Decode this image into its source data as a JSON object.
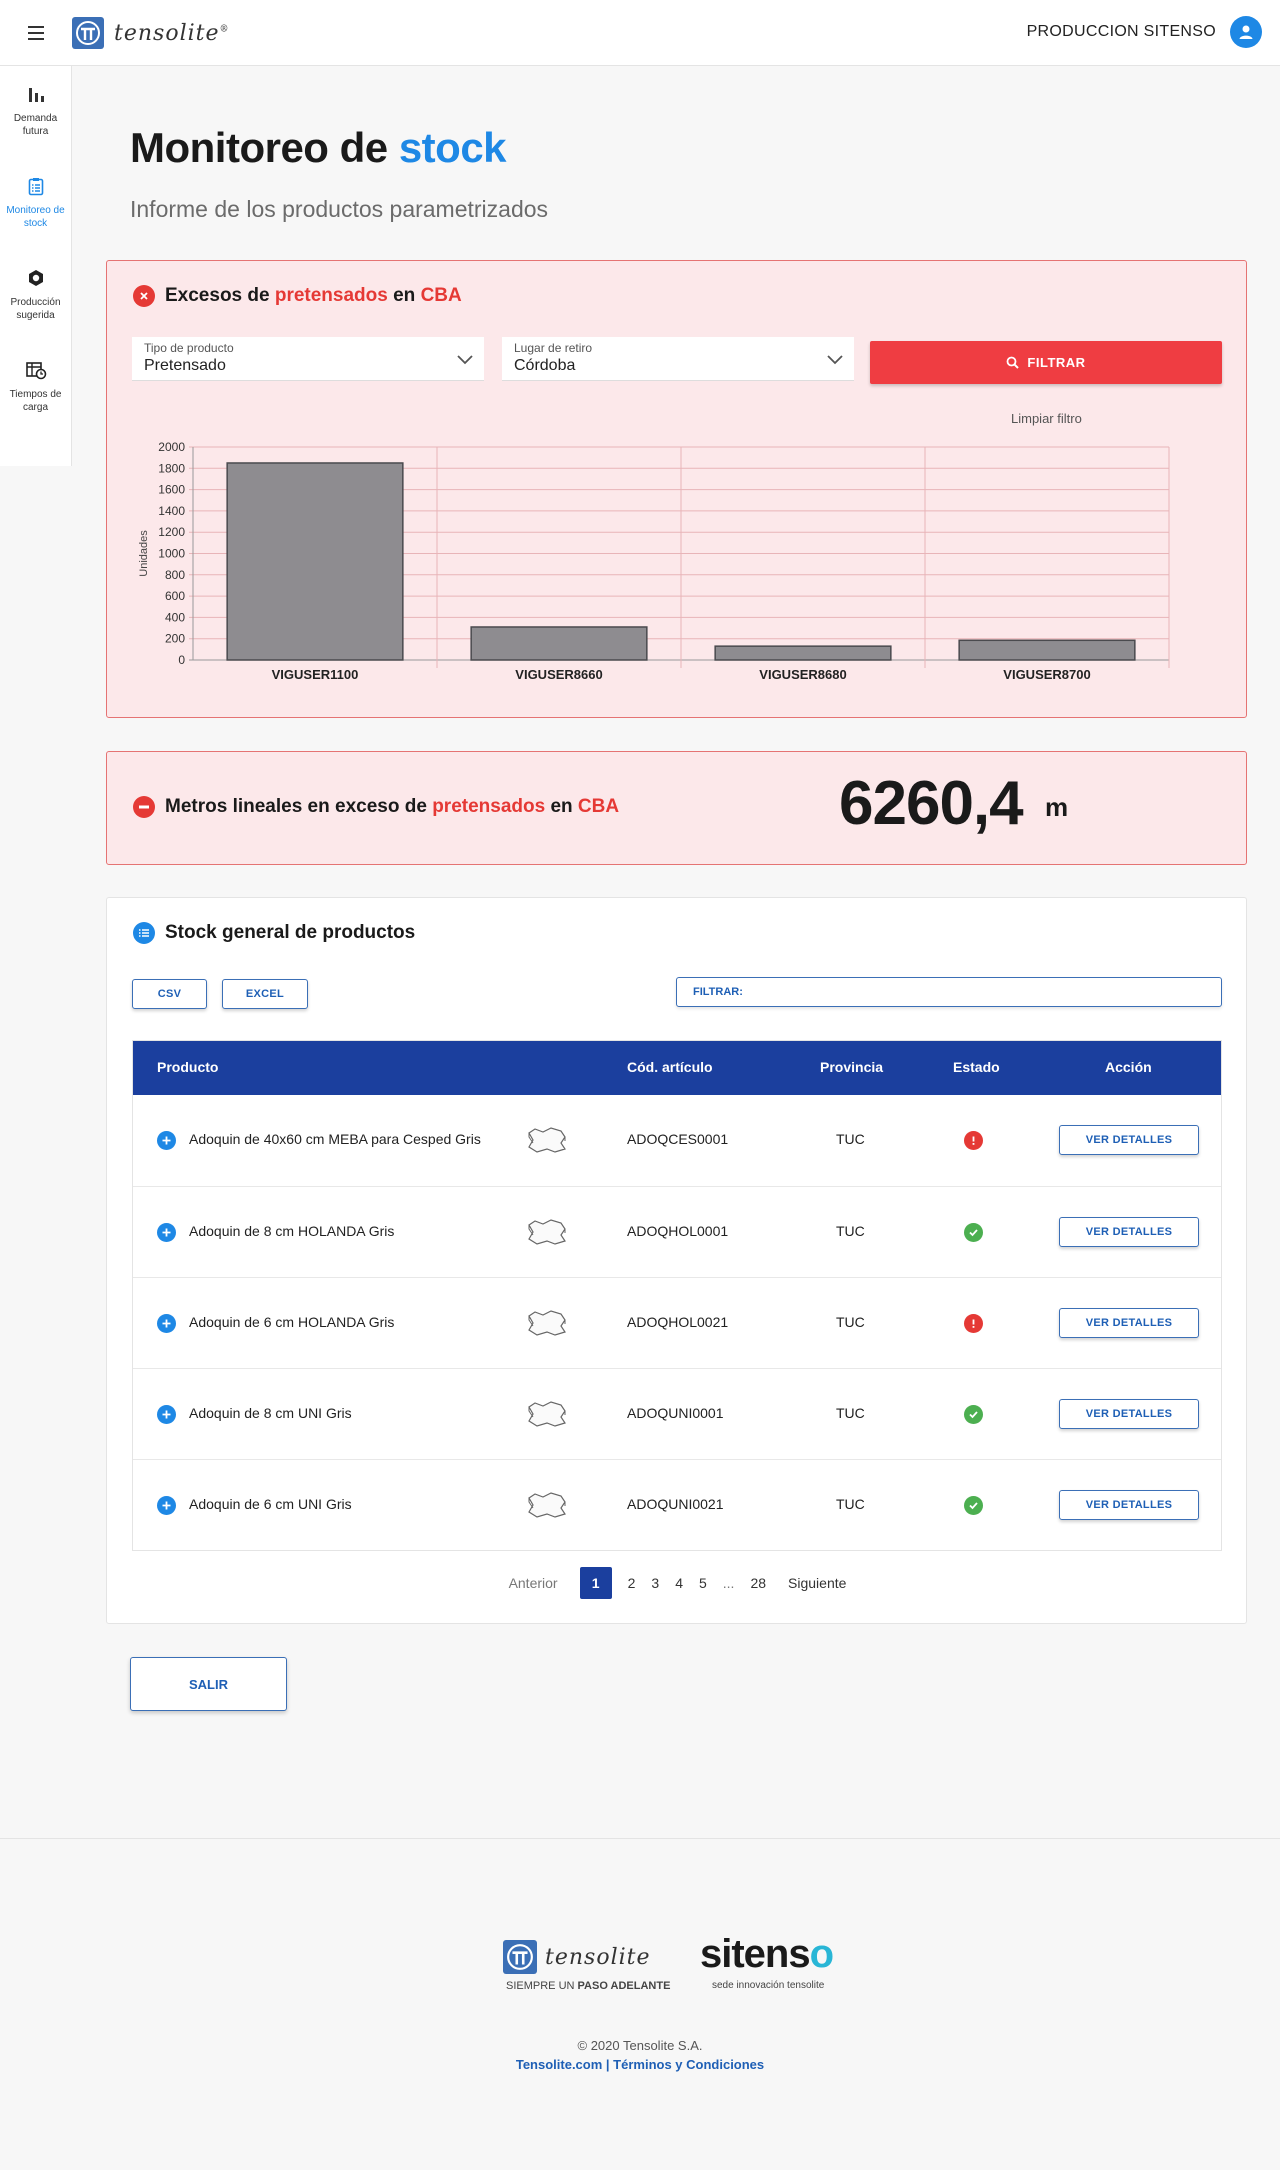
{
  "header": {
    "brand": "tensolite",
    "brand_reg": "®",
    "user_name": "PRODUCCION SITENSO"
  },
  "sidebar": {
    "items": [
      {
        "label": "Demanda futura",
        "icon": "bar-chart-icon",
        "active": false
      },
      {
        "label": "Monitoreo de stock",
        "icon": "clipboard-list-icon",
        "active": true
      },
      {
        "label": "Producción sugerida",
        "icon": "hexagon-icon",
        "active": false
      },
      {
        "label": "Tiempos de carga",
        "icon": "table-clock-icon",
        "active": false
      }
    ]
  },
  "page": {
    "title_main": "Monitoreo de ",
    "title_accent": "stock",
    "subtitle": "Informe de los productos parametrizados"
  },
  "excess_card": {
    "title_a": "Excesos de ",
    "title_b": "pretensados",
    "title_c": " en ",
    "title_d": "CBA",
    "product_type_caption": "Tipo de producto",
    "product_type_value": "Pretensado",
    "location_caption": "Lugar de retiro",
    "location_value": "Córdoba",
    "filter_button": "FILTRAR",
    "clear_filter": "Limpiar filtro"
  },
  "chart_data": {
    "type": "bar",
    "categories": [
      "VIGUSER1100",
      "VIGUSER8660",
      "VIGUSER8680",
      "VIGUSER8700"
    ],
    "values": [
      1850,
      310,
      130,
      185
    ],
    "ylabel": "Unidades",
    "xlabel": "",
    "ylim": [
      0,
      2000
    ],
    "yticks": [
      0,
      200,
      400,
      600,
      800,
      1000,
      1200,
      1400,
      1600,
      1800,
      2000
    ],
    "grid": true,
    "bar_color": "#8e8c90"
  },
  "meters_card": {
    "title_a": "Metros lineales en exceso de ",
    "title_b": "pretensados",
    "title_c": " en ",
    "title_d": "CBA",
    "value": "6260,4",
    "unit": "m"
  },
  "stock_card": {
    "title": "Stock general de productos",
    "csv_button": "CSV",
    "excel_button": "EXCEL",
    "filter_label": "FILTRAR:",
    "filter_value": "",
    "columns": [
      "Producto",
      "Cód. artículo",
      "Provincia",
      "Estado",
      "Acción"
    ],
    "details_button": "VER DETALLES",
    "rows": [
      {
        "product": "Adoquin de 40x60 cm MEBA para Cesped Gris",
        "code": "ADOQCES0001",
        "province": "TUC",
        "status": "error"
      },
      {
        "product": "Adoquin de 8 cm HOLANDA Gris",
        "code": "ADOQHOL0001",
        "province": "TUC",
        "status": "ok"
      },
      {
        "product": "Adoquin de 6 cm HOLANDA Gris",
        "code": "ADOQHOL0021",
        "province": "TUC",
        "status": "error"
      },
      {
        "product": "Adoquin de 8 cm UNI Gris",
        "code": "ADOQUNI0001",
        "province": "TUC",
        "status": "ok"
      },
      {
        "product": "Adoquin de 6 cm UNI Gris",
        "code": "ADOQUNI0021",
        "province": "TUC",
        "status": "ok"
      }
    ],
    "pagination": {
      "prev": "Anterior",
      "pages": [
        "1",
        "2",
        "3",
        "4",
        "5",
        "...",
        "28"
      ],
      "current": "1",
      "next": "Siguiente"
    }
  },
  "exit_button": "SALIR",
  "footer": {
    "brand": "tensolite",
    "slogan_a": "SIEMPRE UN ",
    "slogan_b": "PASO ADELANTE",
    "partner_a": "sitens",
    "partner_b": "o",
    "partner_tagline": "sede innovación tensolite",
    "copyright": "© 2020 Tensolite S.A.",
    "link_site": "Tensolite.com",
    "link_sep": " | ",
    "link_terms": "Términos y Condiciones"
  },
  "colors": {
    "accent_blue": "#1e88e5",
    "table_header": "#1b3f9e",
    "alert_red": "#ef3d42",
    "alert_bg": "#fce8ea",
    "ok_green": "#4caf50"
  }
}
